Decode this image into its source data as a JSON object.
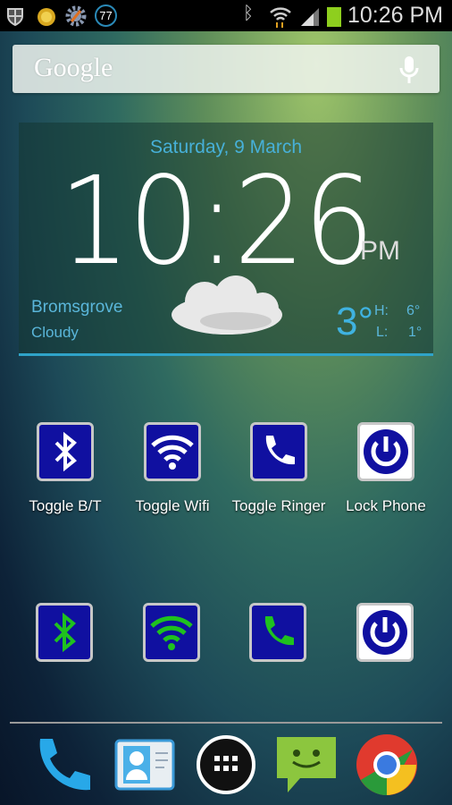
{
  "status_bar": {
    "time": "10:26 PM",
    "notification_badge": "77",
    "battery_color": "#8ecf1e",
    "icons": [
      "shield-icon",
      "sun-icon",
      "settings-gear-icon",
      "counter-badge-icon",
      "bluetooth-icon",
      "wifi-icon",
      "signal-icon",
      "battery-icon"
    ]
  },
  "search": {
    "logo": "Google",
    "mic": "microphone-icon"
  },
  "clock_widget": {
    "date": "Saturday, 9 March",
    "time": "10:26",
    "ampm": "PM",
    "city": "Bromsgrove",
    "condition": "Cloudy",
    "temp": "3°",
    "high_label": "H:",
    "high": "6°",
    "low_label": "L:",
    "low": "1°",
    "accent": "#3fb2e0"
  },
  "shortcuts_row1": [
    {
      "label": "Toggle B/T",
      "icon": "bluetooth-icon"
    },
    {
      "label": "Toggle Wifi",
      "icon": "wifi-icon"
    },
    {
      "label": "Toggle Ringer",
      "icon": "phone-icon"
    },
    {
      "label": "Lock Phone",
      "icon": "power-icon"
    }
  ],
  "shortcuts_row2": [
    {
      "icon": "bluetooth-icon",
      "color": "#1fc11f"
    },
    {
      "icon": "wifi-icon",
      "color": "#1fc11f"
    },
    {
      "icon": "phone-icon",
      "color": "#1fc11f"
    },
    {
      "icon": "power-icon",
      "color": "#ffffff"
    }
  ],
  "dock": [
    "phone-icon",
    "contacts-icon",
    "app-drawer-icon",
    "messaging-icon",
    "chrome-icon"
  ]
}
